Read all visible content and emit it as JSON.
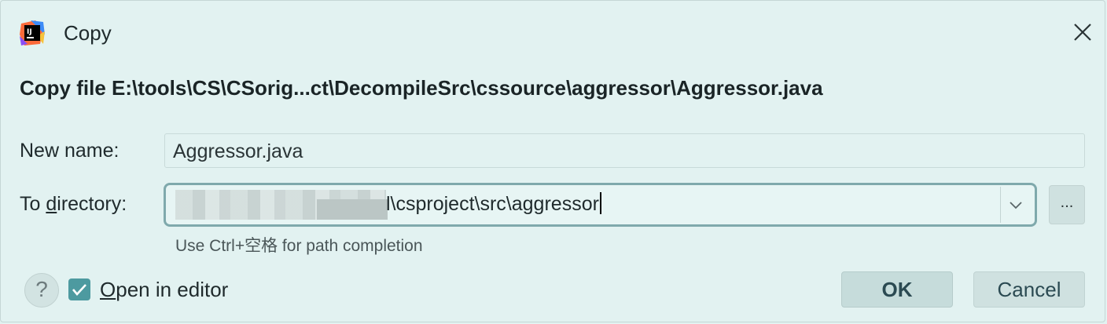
{
  "window": {
    "title": "Copy",
    "icon": "intellij-idea-icon",
    "close_icon": "close-icon"
  },
  "heading": "Copy file E:\\tools\\CS\\CSorig...ct\\DecompileSrc\\cssource\\aggressor\\Aggressor.java",
  "form": {
    "new_name_label": "New name:",
    "new_name_value": "Aggressor.java",
    "to_dir_label_pre": "To ",
    "to_dir_label_mnemonic": "d",
    "to_dir_label_post": "irectory:",
    "to_dir_value": "l\\csproject\\src\\aggressor",
    "browse_label": "...",
    "hint": "Use Ctrl+空格 for path completion"
  },
  "footer": {
    "help_label": "?",
    "open_in_editor_mnemonic": "O",
    "open_in_editor_rest": "pen in editor",
    "open_in_editor_checked": true,
    "ok_label": "OK",
    "cancel_label": "Cancel"
  },
  "colors": {
    "background": "#e2f2f1",
    "accent": "#4d9aa0",
    "focus_border": "#7fa9ac"
  }
}
